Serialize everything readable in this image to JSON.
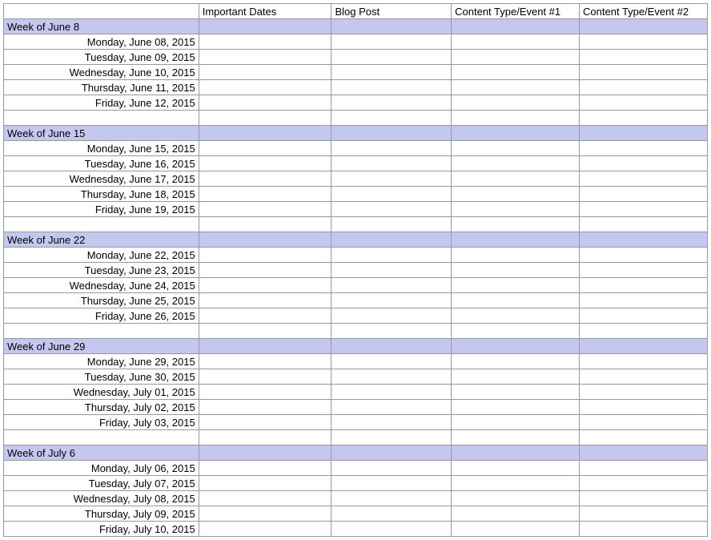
{
  "headers": {
    "col1": "",
    "col2": "Important Dates",
    "col3": "Blog Post",
    "col4": "Content Type/Event #1",
    "col5": "Content Type/Event #2"
  },
  "weeks": [
    {
      "title": "Week of June 8",
      "days": [
        "Monday, June 08, 2015",
        "Tuesday, June 09, 2015",
        "Wednesday, June 10, 2015",
        "Thursday, June 11, 2015",
        "Friday, June 12, 2015"
      ]
    },
    {
      "title": "Week of June 15",
      "days": [
        "Monday, June 15, 2015",
        "Tuesday, June 16, 2015",
        "Wednesday, June 17, 2015",
        "Thursday, June 18, 2015",
        "Friday, June 19, 2015"
      ]
    },
    {
      "title": "Week of June 22",
      "days": [
        "Monday, June 22, 2015",
        "Tuesday, June 23, 2015",
        "Wednesday, June 24, 2015",
        "Thursday, June 25, 2015",
        "Friday, June 26, 2015"
      ]
    },
    {
      "title": "Week of June 29",
      "days": [
        "Monday, June 29, 2015",
        "Tuesday, June 30, 2015",
        "Wednesday, July 01, 2015",
        "Thursday, July 02, 2015",
        "Friday, July 03, 2015"
      ]
    },
    {
      "title": "Week of July 6",
      "days": [
        "Monday, July 06, 2015",
        "Tuesday, July 07, 2015",
        "Wednesday, July 08, 2015",
        "Thursday, July 09, 2015",
        "Friday, July 10, 2015"
      ]
    }
  ]
}
